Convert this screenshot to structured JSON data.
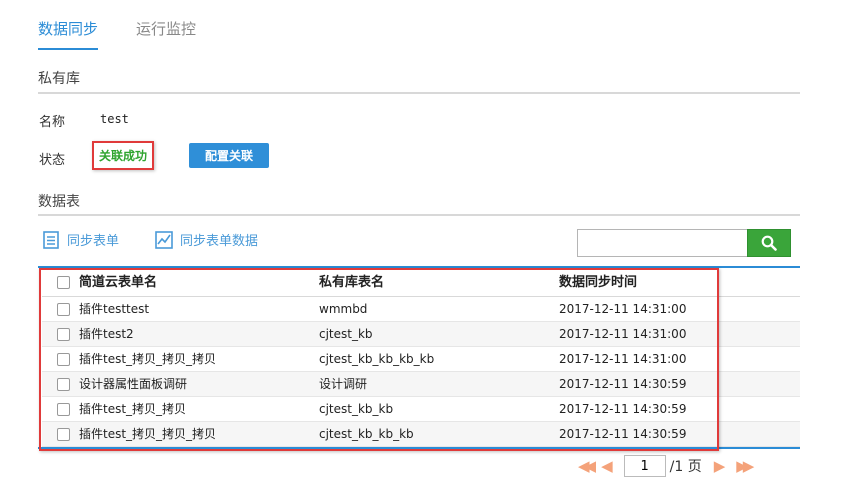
{
  "tabs": [
    {
      "label": "数据同步",
      "active": true
    },
    {
      "label": "运行监控",
      "active": false
    }
  ],
  "private_repo": {
    "section_title": "私有库",
    "name_label": "名称",
    "name_value": "test",
    "status_label": "状态",
    "status_value": "关联成功",
    "status_color": "#2ea42e",
    "config_button": "配置关联"
  },
  "data_table": {
    "section_title": "数据表",
    "sync_form_label": "同步表单",
    "sync_form_data_label": "同步表单数据",
    "search_placeholder": "",
    "search_icon": "search-icon",
    "headers": [
      "简道云表单名",
      "私有库表名",
      "数据同步时间"
    ],
    "rows": [
      [
        "插件testtest",
        "wmmbd",
        "2017-12-11 14:31:00"
      ],
      [
        "插件test2",
        "cjtest_kb",
        "2017-12-11 14:31:00"
      ],
      [
        "插件test_拷贝_拷贝_拷贝",
        "cjtest_kb_kb_kb_kb",
        "2017-12-11 14:31:00"
      ],
      [
        "设计器属性面板调研",
        "设计调研",
        "2017-12-11 14:30:59"
      ],
      [
        "插件test_拷贝_拷贝",
        "cjtest_kb_kb",
        "2017-12-11 14:30:59"
      ],
      [
        "插件test_拷贝_拷贝_拷贝",
        "cjtest_kb_kb_kb",
        "2017-12-11 14:30:59"
      ]
    ]
  },
  "pagination": {
    "current_page": "1",
    "total_label": "/1 页",
    "first_icon": "first-page-icon",
    "prev_icon": "prev-page-icon",
    "next_icon": "next-page-icon",
    "last_icon": "last-page-icon"
  },
  "colors": {
    "accent": "#2b8cd6",
    "success": "#2ea42e",
    "search_button": "#3aa53a",
    "highlight_frame": "#e03a3a",
    "pager_arrows": "#f4a27a"
  }
}
